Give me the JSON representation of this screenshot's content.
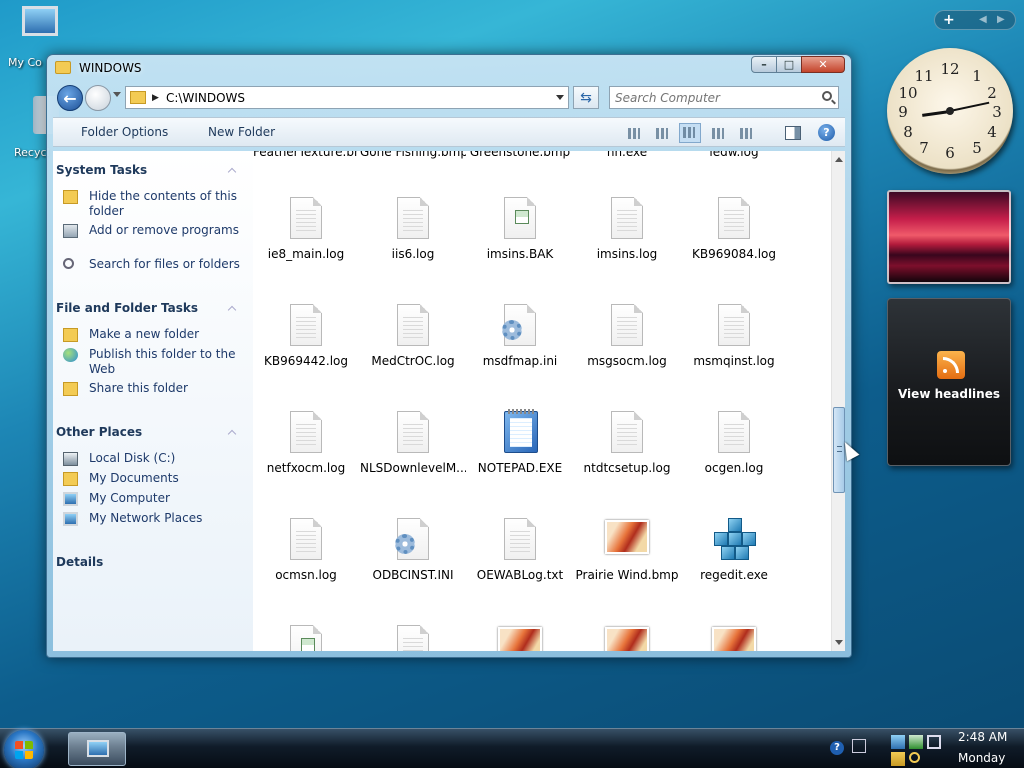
{
  "desktop": {
    "icons": [
      {
        "label": "My Computer",
        "visible": "My Co"
      },
      {
        "label": "Recycle Bin",
        "visible": "Recycl"
      }
    ]
  },
  "window": {
    "title": "WINDOWS",
    "controls": {
      "minimize": "–",
      "maximize": "□",
      "close": "✕"
    }
  },
  "address": {
    "path": "C:\\WINDOWS"
  },
  "search": {
    "placeholder": "Search Computer"
  },
  "toolbar": {
    "folder_options": "Folder Options",
    "new_folder": "New Folder"
  },
  "left_pane": {
    "system_tasks": {
      "title": "System Tasks",
      "items": [
        "Hide the contents of this folder",
        "Add or remove programs",
        "Search for files or folders"
      ]
    },
    "file_folder_tasks": {
      "title": "File and Folder Tasks",
      "items": [
        "Make a new folder",
        "Publish this folder to the Web",
        "Share this folder"
      ]
    },
    "other_places": {
      "title": "Other Places",
      "items": [
        "Local Disk (C:)",
        "My Documents",
        "My Computer",
        "My Network Places"
      ]
    },
    "details": {
      "title": "Details"
    }
  },
  "files": {
    "partial_top": [
      "FeatherTexture.bmp",
      "Gone Fishing.bmp",
      "Greenstone.bmp",
      "hh.exe",
      "iedw.log"
    ],
    "rows": [
      [
        "ie8_main.log",
        "iis6.log",
        "imsins.BAK",
        "imsins.log",
        "KB969084.log"
      ],
      [
        "KB969442.log",
        "MedCtrOC.log",
        "msdfmap.ini",
        "msgsocm.log",
        "msmqinst.log"
      ],
      [
        "netfxocm.log",
        "NLSDownlevelM...",
        "NOTEPAD.EXE",
        "ntdtcsetup.log",
        "ocgen.log"
      ],
      [
        "ocmsn.log",
        "ODBCINST.INI",
        "OEWABLog.txt",
        "Prairie Wind.bmp",
        "regedit.exe"
      ]
    ]
  },
  "gadgets": {
    "clock_numbers": [
      "12",
      "1",
      "2",
      "3",
      "4",
      "5",
      "6",
      "7",
      "8",
      "9",
      "10",
      "11"
    ],
    "clock_time": "2:48",
    "feed_label": "View headlines"
  },
  "taskbar": {
    "time": "2:48 AM",
    "day": "Monday"
  },
  "colors": {
    "taskbar": "#0a1420",
    "window_frame": "#9cc5e2",
    "link": "#1e3a6a"
  }
}
